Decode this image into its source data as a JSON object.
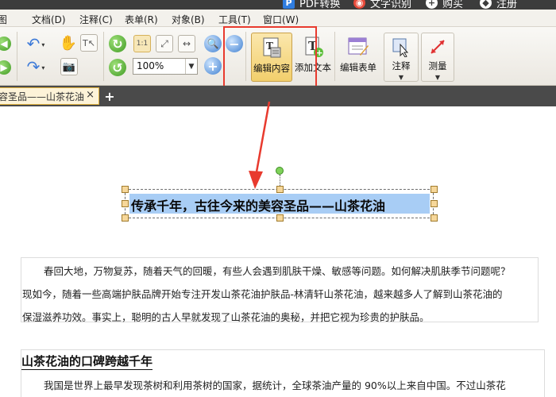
{
  "topbar": {
    "items": [
      {
        "label": "PDF转换",
        "icon": "pdf-convert-icon"
      },
      {
        "label": "文字识别",
        "icon": "ocr-icon"
      },
      {
        "label": "购买",
        "icon": "cart-icon"
      },
      {
        "label": "注册",
        "icon": "register-icon"
      }
    ]
  },
  "menubar": {
    "items": [
      "图",
      "文档(D)",
      "注释(C)",
      "表单(R)",
      "对象(B)",
      "工具(T)",
      "窗口(W)"
    ]
  },
  "toolbar": {
    "zoom_value": "100%",
    "buttons": {
      "edit_content": "编辑内容",
      "add_text": "添加文本",
      "edit_form": "编辑表单",
      "annotate": "注释",
      "measure": "测量"
    }
  },
  "tab": {
    "title": "容圣品——山茶花油",
    "close": "×",
    "add": "+"
  },
  "document": {
    "selected_title": "传承千年，古往今来的美容圣品——山茶花油",
    "paragraph1": [
      "春回大地，万物复苏，随着天气的回暖，有些人会遇到肌肤干燥、敏感等问题。如何解决肌肤季节问题呢？",
      "现如今，随着一些高端护肤品牌开始专注开发山茶花油护肤品-林清轩山茶花油，越来越多人了解到山茶花油的",
      "保湿滋养功效。事实上，聪明的古人早就发现了山茶花油的奥秘，并把它视为珍贵的护肤品。"
    ],
    "heading2": "山茶花油的口碑跨越千年",
    "paragraph2": "我国是世界上最早发现茶树和利用茶树的国家，据统计，全球茶油产量的 90%以上来自中国。不过山茶花"
  },
  "colors": {
    "highlight_frame": "#e83a2e",
    "selection_fill": "#a8cdf5",
    "tab_accent": "#e0b23f"
  }
}
